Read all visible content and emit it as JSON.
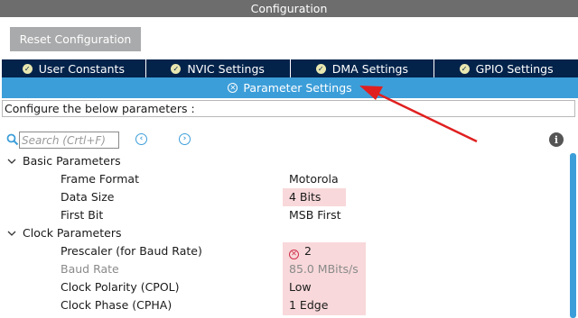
{
  "window": {
    "title": "Configuration"
  },
  "toolbar": {
    "reset_label": "Reset Configuration"
  },
  "tabs": [
    {
      "label": "User Constants",
      "icon": "check-circle-icon"
    },
    {
      "label": "NVIC Settings",
      "icon": "check-circle-icon"
    },
    {
      "label": "DMA Settings",
      "icon": "check-circle-icon"
    },
    {
      "label": "GPIO Settings",
      "icon": "check-circle-icon"
    }
  ],
  "active_tab": {
    "label": "Parameter Settings",
    "icon": "error-circle-icon"
  },
  "instruction": "Configure the below parameters :",
  "search": {
    "placeholder": "Search (Crtl+F)"
  },
  "groups": [
    {
      "label": "Basic Parameters",
      "params": [
        {
          "name": "Frame Format",
          "value": "Motorola"
        },
        {
          "name": "Data Size",
          "value": "4 Bits",
          "highlight": true
        },
        {
          "name": "First Bit",
          "value": "MSB First"
        }
      ]
    },
    {
      "label": "Clock Parameters",
      "params": [
        {
          "name": "Prescaler (for Baud Rate)",
          "value": "2",
          "highlight": true,
          "error": true
        },
        {
          "name": "Baud Rate",
          "value": "85.0 MBits/s",
          "highlight": true,
          "disabled": true
        },
        {
          "name": "Clock Polarity (CPOL)",
          "value": "Low",
          "highlight": true
        },
        {
          "name": "Clock Phase (CPHA)",
          "value": "1 Edge",
          "highlight": true
        }
      ]
    }
  ],
  "colors": {
    "title_bar": "#6d6d6d",
    "tab_bg": "#03234b",
    "active_tab_bg": "#3c9ed9",
    "highlight": "#f8d8da",
    "error": "#d0304a",
    "annotation_arrow": "#e02020"
  }
}
